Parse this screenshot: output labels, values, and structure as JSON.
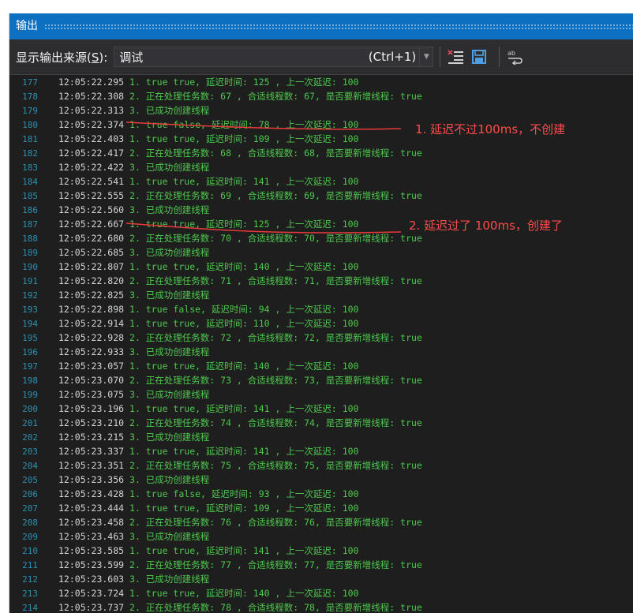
{
  "window": {
    "title": "输出"
  },
  "toolbar": {
    "source_label_pre": "显示输出来源(",
    "source_label_key": "S",
    "source_label_post": "):",
    "source_value": "调试",
    "shortcut": "(Ctrl+1)"
  },
  "icons": {
    "dropdown": "chevron-down-icon",
    "clear": "clear-all-icon",
    "save": "save-icon",
    "wrap": "word-wrap-icon"
  },
  "colors": {
    "title_bar": "#0e70c0",
    "line_number": "#2b91af",
    "message": "#4ec94e",
    "annotation": "#ff4b4b"
  },
  "annotations": [
    {
      "text": "1. 延迟不过100ms，不创建"
    },
    {
      "text": "2. 延迟过了 100ms，创建了"
    }
  ],
  "lines": [
    {
      "n": "177",
      "t": "12:05:22.295",
      "m": "1. true true, 延迟时间: 125 , 上一次延迟: 100"
    },
    {
      "n": "178",
      "t": "12:05:22.308",
      "m": "2. 正在处理任务数: 67 , 合适线程数: 67, 是否要新增线程: true"
    },
    {
      "n": "179",
      "t": "12:05:22.313",
      "m": "3. 已成功创建线程"
    },
    {
      "n": "180",
      "t": "12:05:22.374",
      "m": "1. true false, 延迟时间: 78 , 上一次延迟: 100"
    },
    {
      "n": "181",
      "t": "12:05:22.403",
      "m": "1. true true, 延迟时间: 109 , 上一次延迟: 100"
    },
    {
      "n": "182",
      "t": "12:05:22.417",
      "m": "2. 正在处理任务数: 68 , 合适线程数: 68, 是否要新增线程: true"
    },
    {
      "n": "183",
      "t": "12:05:22.422",
      "m": "3. 已成功创建线程"
    },
    {
      "n": "184",
      "t": "12:05:22.541",
      "m": "1. true true, 延迟时间: 141 , 上一次延迟: 100"
    },
    {
      "n": "185",
      "t": "12:05:22.555",
      "m": "2. 正在处理任务数: 69 , 合适线程数: 69, 是否要新增线程: true"
    },
    {
      "n": "186",
      "t": "12:05:22.560",
      "m": "3. 已成功创建线程"
    },
    {
      "n": "187",
      "t": "12:05:22.667",
      "m": "1. true true, 延迟时间: 125 , 上一次延迟: 100"
    },
    {
      "n": "188",
      "t": "12:05:22.680",
      "m": "2. 正在处理任务数: 70 , 合适线程数: 70, 是否要新增线程: true"
    },
    {
      "n": "189",
      "t": "12:05:22.685",
      "m": "3. 已成功创建线程"
    },
    {
      "n": "190",
      "t": "12:05:22.807",
      "m": "1. true true, 延迟时间: 140 , 上一次延迟: 100"
    },
    {
      "n": "191",
      "t": "12:05:22.820",
      "m": "2. 正在处理任务数: 71 , 合适线程数: 71, 是否要新增线程: true"
    },
    {
      "n": "192",
      "t": "12:05:22.825",
      "m": "3. 已成功创建线程"
    },
    {
      "n": "193",
      "t": "12:05:22.898",
      "m": "1. true false, 延迟时间: 94 , 上一次延迟: 100"
    },
    {
      "n": "194",
      "t": "12:05:22.914",
      "m": "1. true true, 延迟时间: 110 , 上一次延迟: 100"
    },
    {
      "n": "195",
      "t": "12:05:22.928",
      "m": "2. 正在处理任务数: 72 , 合适线程数: 72, 是否要新增线程: true"
    },
    {
      "n": "196",
      "t": "12:05:22.933",
      "m": "3. 已成功创建线程"
    },
    {
      "n": "197",
      "t": "12:05:23.057",
      "m": "1. true true, 延迟时间: 140 , 上一次延迟: 100"
    },
    {
      "n": "198",
      "t": "12:05:23.070",
      "m": "2. 正在处理任务数: 73 , 合适线程数: 73, 是否要新增线程: true"
    },
    {
      "n": "199",
      "t": "12:05:23.075",
      "m": "3. 已成功创建线程"
    },
    {
      "n": "200",
      "t": "12:05:23.196",
      "m": "1. true true, 延迟时间: 141 , 上一次延迟: 100"
    },
    {
      "n": "201",
      "t": "12:05:23.210",
      "m": "2. 正在处理任务数: 74 , 合适线程数: 74, 是否要新增线程: true"
    },
    {
      "n": "202",
      "t": "12:05:23.215",
      "m": "3. 已成功创建线程"
    },
    {
      "n": "203",
      "t": "12:05:23.337",
      "m": "1. true true, 延迟时间: 141 , 上一次延迟: 100"
    },
    {
      "n": "204",
      "t": "12:05:23.351",
      "m": "2. 正在处理任务数: 75 , 合适线程数: 75, 是否要新增线程: true"
    },
    {
      "n": "205",
      "t": "12:05:23.356",
      "m": "3. 已成功创建线程"
    },
    {
      "n": "206",
      "t": "12:05:23.428",
      "m": "1. true false, 延迟时间: 93 , 上一次延迟: 100"
    },
    {
      "n": "207",
      "t": "12:05:23.444",
      "m": "1. true true, 延迟时间: 109 , 上一次延迟: 100"
    },
    {
      "n": "208",
      "t": "12:05:23.458",
      "m": "2. 正在处理任务数: 76 , 合适线程数: 76, 是否要新增线程: true"
    },
    {
      "n": "209",
      "t": "12:05:23.463",
      "m": "3. 已成功创建线程"
    },
    {
      "n": "210",
      "t": "12:05:23.585",
      "m": "1. true true, 延迟时间: 141 , 上一次延迟: 100"
    },
    {
      "n": "211",
      "t": "12:05:23.599",
      "m": "2. 正在处理任务数: 77 , 合适线程数: 77, 是否要新增线程: true"
    },
    {
      "n": "212",
      "t": "12:05:23.603",
      "m": "3. 已成功创建线程"
    },
    {
      "n": "213",
      "t": "12:05:23.724",
      "m": "1. true true, 延迟时间: 140 , 上一次延迟: 100"
    },
    {
      "n": "214",
      "t": "12:05:23.737",
      "m": "2. 正在处理任务数: 78 , 合适线程数: 78, 是否要新增线程: true"
    }
  ]
}
